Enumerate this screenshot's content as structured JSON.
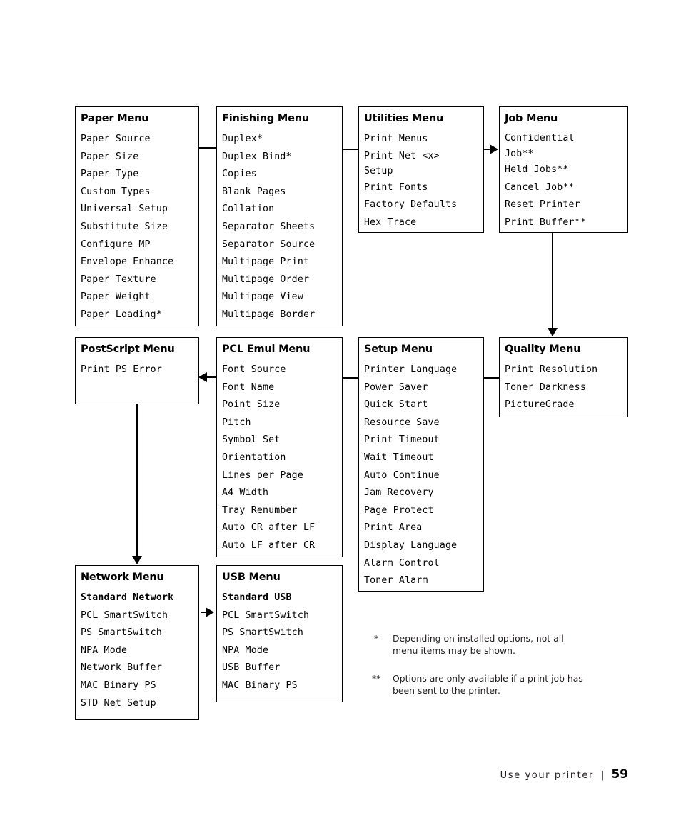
{
  "boxes": {
    "paper": {
      "title": "Paper Menu",
      "items": [
        "Paper Source",
        "Paper Size",
        "Paper Type",
        "Custom Types",
        "Universal Setup",
        "Substitute Size",
        "Configure MP",
        "Envelope Enhance",
        "Paper Texture",
        "Paper Weight",
        "Paper Loading*"
      ]
    },
    "finishing": {
      "title": "Finishing Menu",
      "items": [
        "Duplex*",
        "Duplex Bind*",
        "Copies",
        "Blank Pages",
        "Collation",
        "Separator Sheets",
        "Separator Source",
        "Multipage Print",
        "Multipage Order",
        "Multipage View",
        "Multipage Border"
      ]
    },
    "utilities": {
      "title": "Utilities Menu",
      "items": [
        "Print Menus",
        "Print Net <x>\nSetup",
        "Print Fonts",
        "Factory Defaults",
        "Hex Trace"
      ]
    },
    "job": {
      "title": "Job Menu",
      "items": [
        "Confidential\nJob**",
        "Held Jobs**",
        "Cancel Job**",
        "Reset Printer",
        "Print Buffer**"
      ]
    },
    "postscript": {
      "title": "PostScript Menu",
      "items": [
        "Print PS Error"
      ]
    },
    "pcl": {
      "title": "PCL Emul Menu",
      "items": [
        "Font Source",
        "Font Name",
        "Point Size",
        "Pitch",
        "Symbol Set",
        "Orientation",
        "Lines per Page",
        "A4 Width",
        "Tray Renumber",
        "Auto CR after LF",
        "Auto LF after CR"
      ]
    },
    "setup": {
      "title": "Setup Menu",
      "items": [
        "Printer Language",
        "Power Saver",
        "Quick Start",
        "Resource Save",
        "Print Timeout",
        "Wait Timeout",
        "Auto Continue",
        "Jam Recovery",
        "Page Protect",
        "Print Area",
        "Display Language",
        "Alarm Control",
        "Toner Alarm"
      ]
    },
    "quality": {
      "title": "Quality Menu",
      "items": [
        "Print Resolution",
        "Toner Darkness",
        "PictureGrade"
      ]
    },
    "network": {
      "title": "Network Menu",
      "subhead": "Standard Network",
      "items": [
        "PCL SmartSwitch",
        "PS SmartSwitch",
        "NPA Mode",
        "Network Buffer",
        "MAC Binary PS",
        "STD Net Setup"
      ]
    },
    "usb": {
      "title": "USB Menu",
      "subhead": "Standard USB",
      "items": [
        "PCL SmartSwitch",
        "PS SmartSwitch",
        "NPA Mode",
        "USB Buffer",
        "MAC Binary PS"
      ]
    }
  },
  "footnotes": [
    {
      "mark": "*",
      "text": "Depending on installed options, not all menu items may be shown."
    },
    {
      "mark": "**",
      "text": "Options are only available if a print job has been sent to the printer."
    }
  ],
  "footer": {
    "label": "Use your printer",
    "separator": "|",
    "page": "59"
  },
  "colors": {
    "ink": "#000000",
    "body_text": "#231f20",
    "background": "#ffffff"
  }
}
